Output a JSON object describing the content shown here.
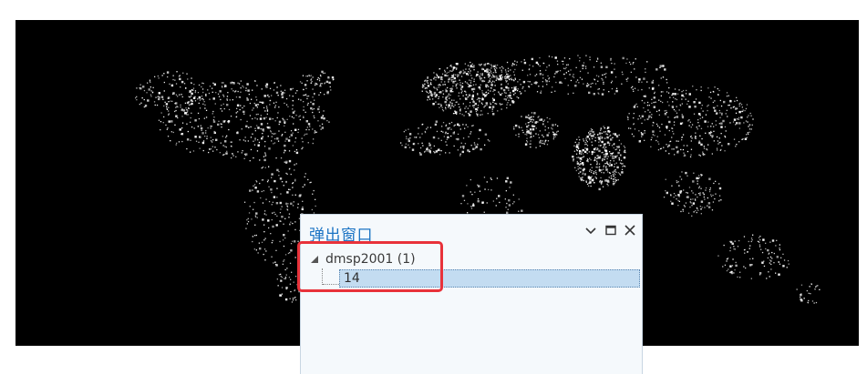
{
  "popup": {
    "title": "弹出窗口",
    "layer_label": "dmsp2001 (1)",
    "feature_value": "14"
  },
  "icons": {
    "options": "chevron-down-icon",
    "maximize": "maximize-icon",
    "close": "close-icon",
    "expander": "triangle-expanded-icon"
  },
  "colors": {
    "map_background": "#000000",
    "city_lights": "#ffffff",
    "popup_title": "#1c74c4",
    "selection": "#c3dcf1",
    "annotation": "#e8323a"
  }
}
